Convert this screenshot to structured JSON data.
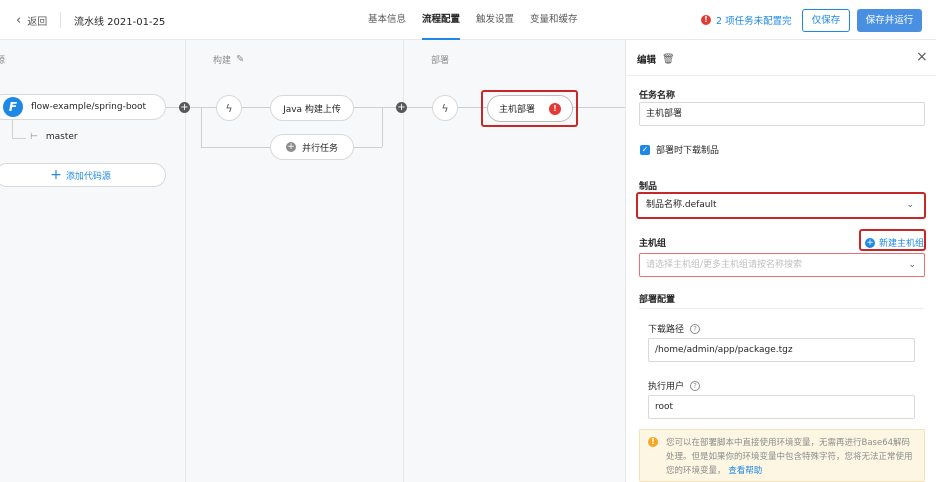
{
  "header": {
    "back_label": "返回",
    "pipeline_title": "流水线 2021-01-25",
    "tabs": [
      {
        "label": "基本信息",
        "active": false
      },
      {
        "label": "流程配置",
        "active": true
      },
      {
        "label": "触发设置",
        "active": false
      },
      {
        "label": "变量和缓存",
        "active": false
      }
    ],
    "warning_count_icon": "!",
    "warning_text": "2 项任务未配置完",
    "save_label": "仅保存",
    "save_run_label": "保存并运行"
  },
  "canvas": {
    "stage_source_label": "源",
    "stage_build_label": "构建",
    "stage_deploy_label": "部署",
    "source": {
      "repo": "flow-example/spring-boot",
      "logo_letter": "F",
      "branch": "master",
      "add_source_label": "添加代码源"
    },
    "build": {
      "task_label": "Java 构建上传",
      "parallel_label": "并行任务"
    },
    "deploy": {
      "task_label": "主机部署",
      "error_icon": "!"
    }
  },
  "panel": {
    "title": "编辑",
    "task_name_label": "任务名称",
    "task_name_value": "主机部署",
    "download_checkbox_label": "部署时下载制品",
    "download_checked": true,
    "artifact_label": "制品",
    "artifact_value": "制品名称.default",
    "host_group_label": "主机组",
    "new_host_group_label": "新建主机组",
    "host_group_placeholder": "请选择主机组/更多主机组请按名称搜索",
    "deploy_config_label": "部署配置",
    "download_path_label": "下载路径",
    "download_path_value": "/home/admin/app/package.tgz",
    "exec_user_label": "执行用户",
    "exec_user_value": "root",
    "notice_text": "您可以在部署脚本中直接使用环境变量，无需再进行Base64解码处理。但是如果你的环境变量中包含特殊字符，您将无法正常使用您的环境变量，",
    "notice_link": "查看帮助"
  },
  "colors": {
    "primary": "#1e88e5",
    "error": "#e53935",
    "highlight_outline": "#c62828",
    "warning": "#f5a623"
  }
}
